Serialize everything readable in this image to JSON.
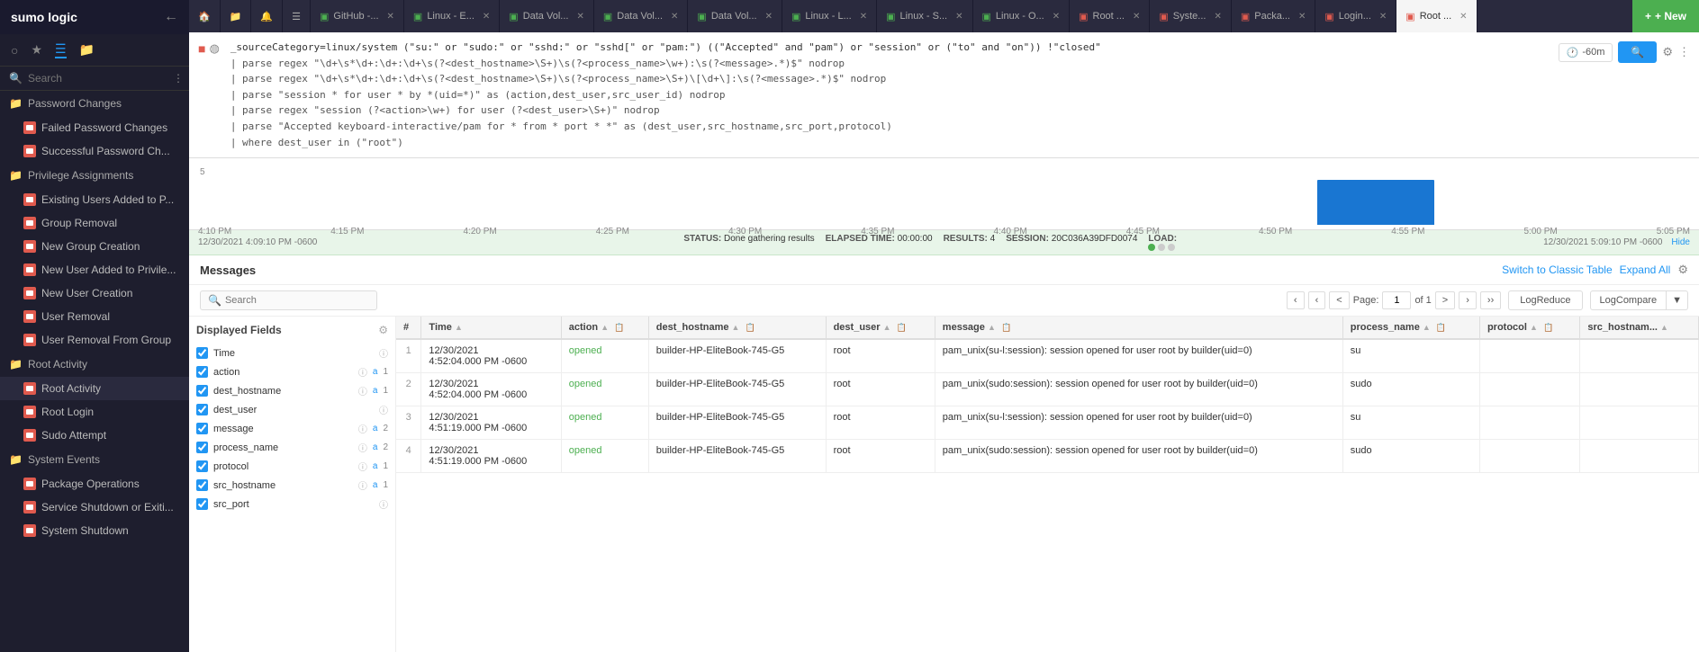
{
  "sidebar": {
    "logo": "sumo logic",
    "categories": [
      {
        "name": "Password Changes",
        "items": [
          {
            "label": "Failed Password Changes"
          },
          {
            "label": "Successful Password Ch..."
          }
        ]
      },
      {
        "name": "Privilege Assignments",
        "items": [
          {
            "label": "Existing Users Added to P..."
          },
          {
            "label": "Group Removal"
          },
          {
            "label": "New Group Creation"
          },
          {
            "label": "New User Added to Privile..."
          },
          {
            "label": "New User Creation"
          },
          {
            "label": "User Removal"
          },
          {
            "label": "User Removal From Group"
          }
        ]
      },
      {
        "name": "Root Activity",
        "items": [
          {
            "label": "Root Activity"
          },
          {
            "label": "Root Login"
          },
          {
            "label": "Sudo Attempt"
          }
        ]
      },
      {
        "name": "System Events",
        "items": [
          {
            "label": "Package Operations"
          },
          {
            "label": "Service Shutdown or Exiti..."
          },
          {
            "label": "System Shutdown"
          }
        ]
      }
    ]
  },
  "tabs": [
    {
      "label": "🏠",
      "type": "home",
      "active": false
    },
    {
      "label": "📁",
      "type": "folder",
      "active": false
    },
    {
      "label": "🔔",
      "type": "bell",
      "active": false
    },
    {
      "label": "📋",
      "type": "list",
      "active": false
    },
    {
      "label": "GitHub -...",
      "active": false,
      "color": "#4caf50"
    },
    {
      "label": "Linux - E...",
      "active": false,
      "color": "#4caf50"
    },
    {
      "label": "Data Vol...",
      "active": false,
      "color": "#4caf50"
    },
    {
      "label": "Data Vol...",
      "active": false,
      "color": "#4caf50"
    },
    {
      "label": "Data Vol...",
      "active": false,
      "color": "#4caf50"
    },
    {
      "label": "Linux - L...",
      "active": false,
      "color": "#4caf50"
    },
    {
      "label": "Linux - S...",
      "active": false,
      "color": "#4caf50"
    },
    {
      "label": "Linux - O...",
      "active": false,
      "color": "#4caf50"
    },
    {
      "label": "Root ...",
      "active": false,
      "color": "#e05a4e"
    },
    {
      "label": "Syste...",
      "active": false,
      "color": "#e05a4e"
    },
    {
      "label": "Packa...",
      "active": false,
      "color": "#e05a4e"
    },
    {
      "label": "Login...",
      "active": false,
      "color": "#e05a4e"
    },
    {
      "label": "Root ...",
      "active": true,
      "color": "#e05a4e"
    }
  ],
  "new_button": "+ New",
  "query": {
    "line1": "_sourceCategory=linux/system (\"su:\" or \"sudo:\" or \"sshd:\" or \"sshd[\" or \"pam:\") ((\"Accepted\" and \"pam\") or \"session\" or (\"to\" and \"on\")) !\"closed\"",
    "line2": "| parse regex \"\\d+\\s*\\d+:\\d+:\\d+\\s(?<dest_hostname>\\S+)\\s(?<process_name>\\w+):\\s(?<message>.*)$\" nodrop",
    "line3": "| parse regex \"\\d+\\s*\\d+:\\d+:\\d+\\s(?<dest_hostname>\\S+)\\s(?<process_name>\\S+)\\[\\d+\\]:\\s(?<message>.*)$\" nodrop",
    "line4": "| parse \"session * for user * by *(uid=*)\" as (action,dest_user,src_user_id) nodrop",
    "line5": "| parse regex \"session (?<action>\\w+) for user (?<dest_user>\\S+)\" nodrop",
    "line6": "| parse \"Accepted keyboard-interactive/pam for * from * port * *\" as (dest_user,src_hostname,src_port,protocol)",
    "line7": "| where dest_user in (\"root\")"
  },
  "time_range": "-60m",
  "status": {
    "left_time": "12/30/2021 4:09:10 PM -0600",
    "status_label": "STATUS:",
    "status_value": "Done gathering results",
    "elapsed_label": "ELAPSED TIME:",
    "elapsed_value": "00:00:00",
    "results_label": "RESULTS:",
    "results_value": "4",
    "session_label": "SESSION:",
    "session_value": "20C036A39DFD0074",
    "load_label": "LOAD:",
    "right_time": "12/30/2021 5:09:10 PM -0600"
  },
  "messages": {
    "title": "Messages",
    "switch_classic": "Switch to Classic Table",
    "expand_all": "Expand All",
    "search_placeholder": "Search",
    "page_current": "1",
    "page_total": "of 1",
    "logreducer": "LogReduce",
    "logcompare": "LogCompare"
  },
  "fields": {
    "title": "Displayed Fields",
    "items": [
      {
        "name": "Time",
        "checked": true,
        "info": true,
        "count": null
      },
      {
        "name": "action",
        "checked": true,
        "info": true,
        "count": 1,
        "link": true
      },
      {
        "name": "dest_hostname",
        "checked": true,
        "info": true,
        "count": 1,
        "link": true
      },
      {
        "name": "dest_user",
        "checked": true,
        "info": true,
        "count": null
      },
      {
        "name": "message",
        "checked": true,
        "info": true,
        "count": 2,
        "link": true
      },
      {
        "name": "process_name",
        "checked": true,
        "info": true,
        "count": 2,
        "link": true
      },
      {
        "name": "protocol",
        "checked": true,
        "info": true,
        "count": 1,
        "link": true
      },
      {
        "name": "src_hostname",
        "checked": true,
        "info": true,
        "count": 1,
        "link": true
      },
      {
        "name": "src_port",
        "checked": true,
        "info": true,
        "count": null
      }
    ]
  },
  "table": {
    "columns": [
      "#",
      "Time",
      "action",
      "dest_hostname",
      "dest_user",
      "message",
      "process_name",
      "protocol",
      "src_hostnam..."
    ],
    "rows": [
      {
        "num": "1",
        "time": "12/30/2021\n4:52:04.000 PM -0600",
        "action": "opened",
        "dest_hostname": "builder-HP-EliteBook-745-G5",
        "dest_user": "root",
        "message": "pam_unix(su-l:session): session opened for user root by builder(uid=0)",
        "process_name": "su",
        "protocol": "",
        "src_hostname": ""
      },
      {
        "num": "2",
        "time": "12/30/2021\n4:52:04.000 PM -0600",
        "action": "opened",
        "dest_hostname": "builder-HP-EliteBook-745-G5",
        "dest_user": "root",
        "message": "pam_unix(sudo:session): session opened for user root by builder(uid=0)",
        "process_name": "sudo",
        "protocol": "",
        "src_hostname": ""
      },
      {
        "num": "3",
        "time": "12/30/2021\n4:51:19.000 PM -0600",
        "action": "opened",
        "dest_hostname": "builder-HP-EliteBook-745-G5",
        "dest_user": "root",
        "message": "pam_unix(su-l:session): session opened for user root by builder(uid=0)",
        "process_name": "su",
        "protocol": "",
        "src_hostname": ""
      },
      {
        "num": "4",
        "time": "12/30/2021\n4:51:19.000 PM -0600",
        "action": "opened",
        "dest_hostname": "builder-HP-EliteBook-745-G5",
        "dest_user": "root",
        "message": "pam_unix(sudo:session): session opened for user root by builder(uid=0)",
        "process_name": "sudo",
        "protocol": "",
        "src_hostname": ""
      }
    ]
  },
  "chart": {
    "y_label": "5",
    "times": [
      "4:10 PM",
      "4:15 PM",
      "4:20 PM",
      "4:25 PM",
      "4:30 PM",
      "4:35 PM",
      "4:40 PM",
      "4:45 PM",
      "4:50 PM",
      "4:55 PM",
      "5:00 PM",
      "5:05 PM"
    ],
    "bars": [
      0,
      0,
      0,
      0,
      0,
      0,
      0,
      0,
      0,
      4,
      0,
      0
    ],
    "highlight_index": 9
  }
}
